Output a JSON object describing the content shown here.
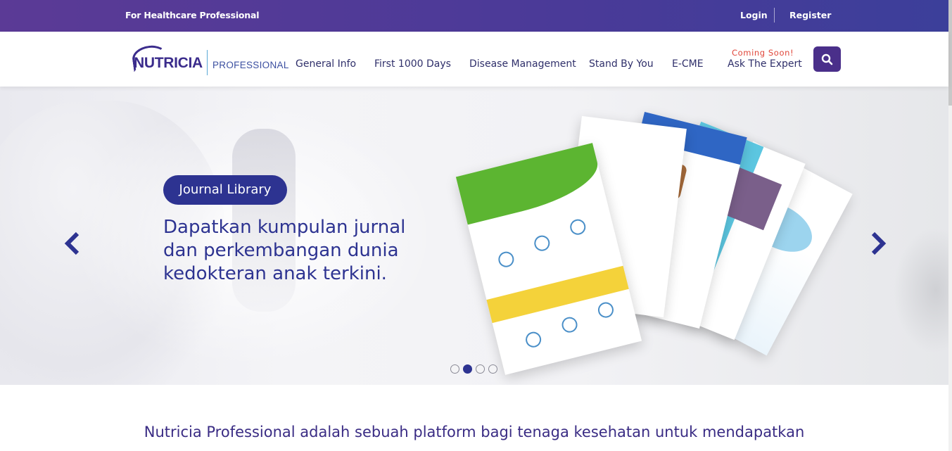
{
  "topbar": {
    "audience_label": "For Healthcare Professional",
    "login": "Login",
    "register": "Register"
  },
  "navbar": {
    "logo_brand": "NUTRICIA",
    "logo_sub": "PROFESSIONAL",
    "items": [
      {
        "label": "General Info"
      },
      {
        "label": "First 1000 Days"
      },
      {
        "label": "Disease Management"
      },
      {
        "label": "Stand By You"
      },
      {
        "label": "E-CME"
      },
      {
        "label": "Ask The Expert"
      }
    ],
    "coming_soon": "Coming Soon!",
    "search_icon": "search-icon"
  },
  "hero": {
    "pill": "Journal Library",
    "headline": "Dapatkan kumpulan jurnal dan perkembangan dunia kedokteran anak terkini.",
    "prev_icon": "chevron-left-icon",
    "next_icon": "chevron-right-icon",
    "slides_total": 4,
    "active_slide": 2
  },
  "intro": {
    "line1": "Nutricia Professional adalah sebuah platform bagi tenaga kesehatan untuk mendapatkan"
  },
  "colors": {
    "topbar": "#4a3a98",
    "brand": "#3b2c8c",
    "hero_text": "#2d3391",
    "coming_soon": "#e0463a"
  }
}
